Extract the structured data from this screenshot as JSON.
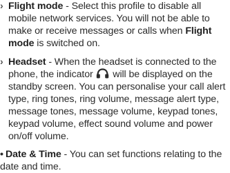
{
  "sections": {
    "flight_mode": {
      "marker": "›",
      "term": "Flight mode",
      "text_1": " - Select this profile to disable all mobile network services. You will not be able to make or receive messages or calls when ",
      "term_repeat": "Flight mode",
      "text_2": " is switched on."
    },
    "headset": {
      "marker": "›",
      "term": "Headset",
      "text_1": " - When the headset is connected to the phone, the indicator ",
      "icon": "headset-icon",
      "text_2": " will be displayed on the standby screen. You can personalise your call alert type, ring tones, ring volume, message alert type, message tones, message volume, keypad tones, keypad volume, effect sound volume and power on/off volume."
    },
    "date_time": {
      "marker": "•",
      "term": "Date & Time",
      "text_1": " - You can set functions relating to the date and time."
    }
  }
}
